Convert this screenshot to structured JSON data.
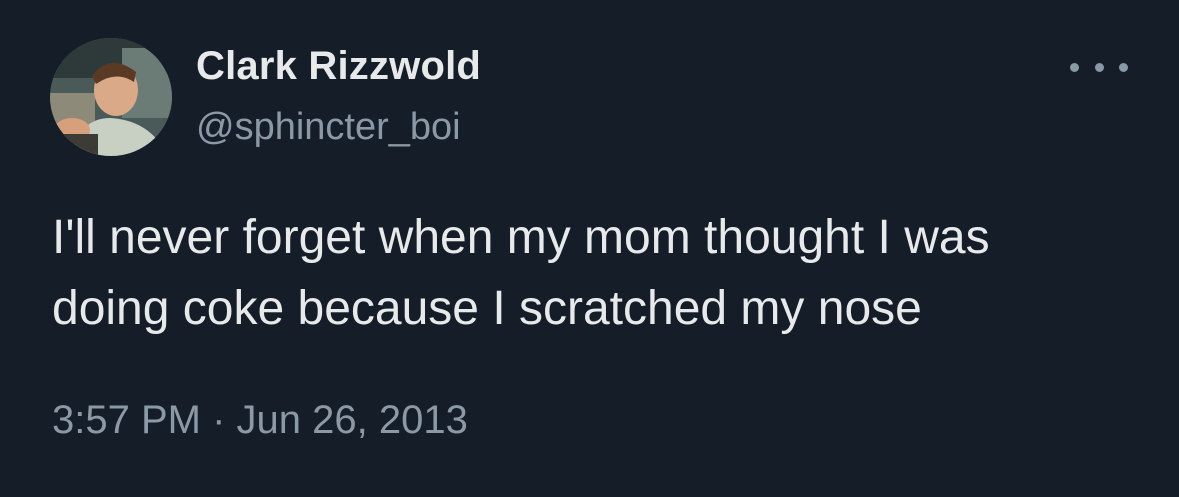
{
  "tweet": {
    "author": {
      "display_name": "Clark Rizzwold",
      "handle": "@sphincter_boi",
      "avatar_icon": "profile-photo"
    },
    "more_icon": "more-options-icon",
    "text_lines": [
      "I'll never forget when my mom thought I was",
      "doing coke because I scratched my nose"
    ],
    "time": "3:57 PM",
    "separator": "·",
    "date": "Jun 26, 2013"
  },
  "colors": {
    "background": "#151d29",
    "primary_text": "#e7e9ea",
    "secondary_text": "#8b98a5"
  }
}
